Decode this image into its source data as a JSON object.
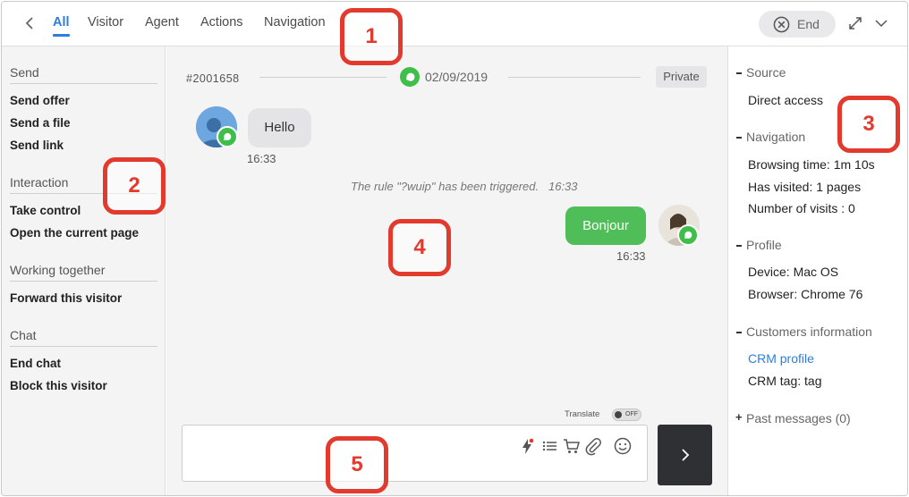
{
  "topbar": {
    "tabs": [
      "All",
      "Visitor",
      "Agent",
      "Actions",
      "Navigation"
    ],
    "end_label": "End"
  },
  "sidebar": {
    "sections": [
      {
        "title": "Send",
        "actions": [
          "Send offer",
          "Send a file",
          "Send link"
        ]
      },
      {
        "title": "Interaction",
        "actions": [
          "Take control",
          "Open the current page"
        ]
      },
      {
        "title": "Working together",
        "actions": [
          "Forward this visitor"
        ]
      },
      {
        "title": "Chat",
        "actions": [
          "End chat",
          "Block this visitor"
        ]
      }
    ]
  },
  "conversation": {
    "ticket_id": "#2001658",
    "date": "02/09/2019",
    "visibility": "Private",
    "messages": [
      {
        "direction": "incoming",
        "text": "Hello",
        "time": "16:33"
      },
      {
        "direction": "system",
        "text": "The rule \"?wuip\" has been triggered.",
        "time": "16:33"
      },
      {
        "direction": "outgoing",
        "text": "Bonjour",
        "time": "16:33"
      }
    ]
  },
  "composer": {
    "translate_label": "Translate",
    "translate_state": "OFF",
    "input_value": "",
    "tools": [
      "lightning-icon",
      "list-icon",
      "cart-icon",
      "paperclip-icon",
      "smiley-icon"
    ]
  },
  "details": {
    "source_title": "Source",
    "source_value": "Direct access",
    "navigation_title": "Navigation",
    "browsing_time": "Browsing time: 1m 10s",
    "has_visited": "Has visited: 1 pages",
    "visits": "Number of visits : 0",
    "profile_title": "Profile",
    "device": "Device: Mac OS",
    "browser": "Browser: Chrome 76",
    "customers_title": "Customers information",
    "crm_profile": "CRM profile",
    "crm_tag": "CRM tag: tag",
    "past_messages": "Past messages (0)"
  },
  "markers": [
    "1",
    "2",
    "3",
    "4",
    "5"
  ],
  "colors": {
    "accent": "#2a7de1",
    "green": "#4fbe58",
    "marker": "#e23b2e",
    "send_button": "#2e3033"
  }
}
